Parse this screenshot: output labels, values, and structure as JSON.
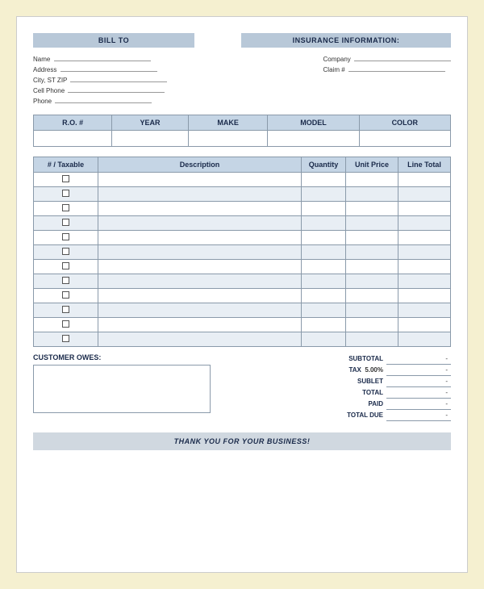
{
  "header": {
    "bill_to_label": "BILL TO",
    "insurance_label": "INSURANCE INFORMATION:"
  },
  "bill_to_fields": [
    {
      "label": "Name"
    },
    {
      "label": "Address"
    },
    {
      "label": "City, ST ZIP"
    },
    {
      "label": "Cell Phone"
    },
    {
      "label": "Phone"
    }
  ],
  "insurance_fields": [
    {
      "label": "Company"
    },
    {
      "label": "Claim #"
    }
  ],
  "vehicle_table": {
    "columns": [
      "R.O. #",
      "YEAR",
      "MAKE",
      "MODEL",
      "COLOR"
    ]
  },
  "items_table": {
    "columns": [
      "# / Taxable",
      "Description",
      "Quantity",
      "Unit Price",
      "Line Total"
    ],
    "row_count": 12
  },
  "totals": {
    "subtotal_label": "SUBTOTAL",
    "subtotal_value": "-",
    "tax_label": "TAX",
    "tax_percent": "5.00%",
    "tax_value": "-",
    "sublet_label": "SUBLET",
    "sublet_value": "-",
    "total_label": "TOTAL",
    "total_value": "-",
    "paid_label": "PAID",
    "paid_value": "-",
    "total_due_label": "TOTAL DUE",
    "total_due_value": "-"
  },
  "customer_owes": {
    "label": "CUSTOMER OWES:"
  },
  "footer": {
    "text": "THANK YOU FOR YOUR BUSINESS!"
  }
}
